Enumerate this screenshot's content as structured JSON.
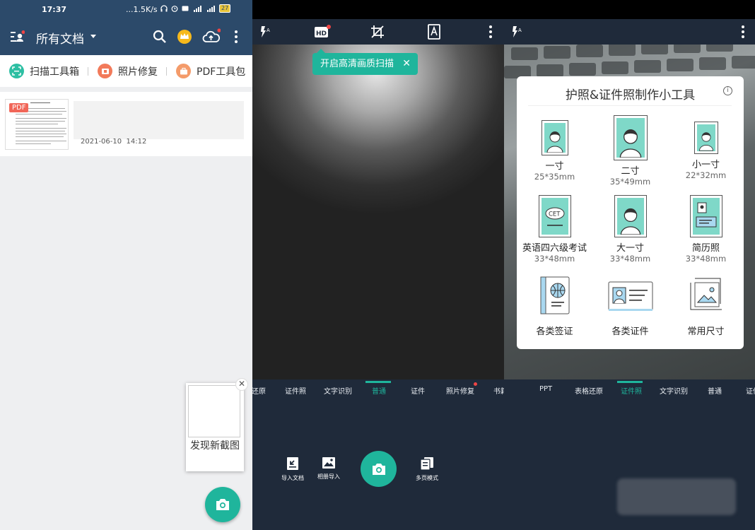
{
  "status_bar": {
    "time": "17:37",
    "network": "...1.5K/s",
    "battery": "27"
  },
  "left_app": {
    "title": "所有文档",
    "tools": [
      {
        "label": "扫描工具箱",
        "icon": "scan-toolbox-icon",
        "color": "#2dbfa3"
      },
      {
        "label": "照片修复",
        "icon": "photo-repair-icon",
        "color": "#f27a5a"
      },
      {
        "label": "PDF工具包",
        "icon": "pdf-toolkit-icon",
        "color": "#f49b6a"
      }
    ],
    "document": {
      "badge": "PDF",
      "date": "2021-06-10",
      "time": "14:12"
    },
    "new_screenshot": {
      "label": "发现新截图"
    }
  },
  "middle_camera": {
    "hd_tip": "开启高清画质扫描",
    "modes": [
      "还原",
      "证件照",
      "文字识别",
      "普通",
      "证件",
      "照片修复",
      "书籍"
    ],
    "active_mode": "普通",
    "bottom_buttons": [
      "导入文档",
      "相册导入",
      "多页模式"
    ]
  },
  "right_camera": {
    "modes": [
      "PPT",
      "表格还原",
      "证件照",
      "文字识别",
      "普通",
      "证件"
    ],
    "active_mode": "证件照",
    "card": {
      "title": "护照&证件照制作小工具",
      "items": [
        {
          "name": "一寸",
          "size": "25*35mm"
        },
        {
          "name": "二寸",
          "size": "35*49mm"
        },
        {
          "name": "小一寸",
          "size": "22*32mm"
        },
        {
          "name": "英语四六级考试",
          "size": "33*48mm"
        },
        {
          "name": "大一寸",
          "size": "33*48mm"
        },
        {
          "name": "简历照",
          "size": "33*48mm"
        },
        {
          "name": "各类签证",
          "size": ""
        },
        {
          "name": "各类证件",
          "size": ""
        },
        {
          "name": "常用尺寸",
          "size": ""
        }
      ]
    }
  },
  "colors": {
    "accent": "#1fb59c",
    "header": "#2c4a6a",
    "camera_bar": "#1f2a3a"
  }
}
